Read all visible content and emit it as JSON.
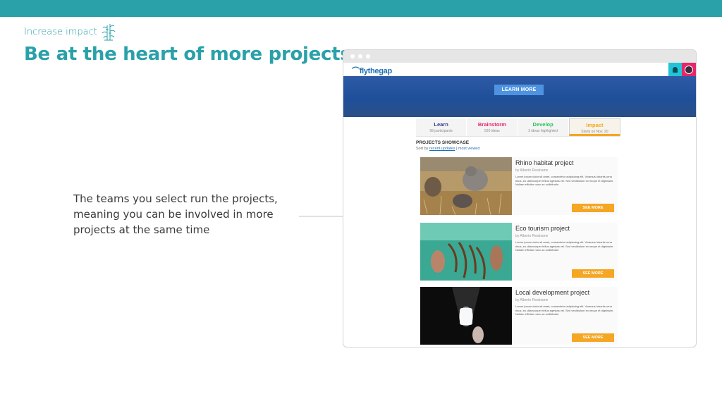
{
  "slide": {
    "kicker": "Increase impact",
    "kicker_icon": "bamboo-icon",
    "title": "Be at the heart of more projects",
    "body": "The teams you select run the projects, meaning you can be involved in more projects at the same time",
    "accent_color": "#2aa1a9"
  },
  "browser": {
    "logo": "flythegap",
    "header_icons": [
      "bell-icon",
      "avatar"
    ],
    "hero_button": "LEARN MORE",
    "tabs": [
      {
        "label": "Learn",
        "sub": "99 participants",
        "color": "#3a3a8a"
      },
      {
        "label": "Brainstorm",
        "sub": "520 ideas",
        "color": "#e6266b"
      },
      {
        "label": "Develop",
        "sub": "3 ideas highlighted",
        "color": "#2ac25a"
      },
      {
        "label": "Impact",
        "sub": "Starts on Nov. 20",
        "color": "#f5a623"
      }
    ],
    "showcase": {
      "title": "PROJECTS SHOWCASE",
      "sort_prefix": "Sort by",
      "sort_recent": "recent updates",
      "sort_sep": " | ",
      "sort_viewed": "most viewed"
    },
    "projects": [
      {
        "title": "Rhino habitat project",
        "author": "by Alberto Realname",
        "desc": "Lorem ipsum dolor sit amet, consectetur adipiscing elit. Vivamus lobortis urna risus, eu ullamcorper tellus egestas vel. Sed vestibulum ex neque et dignissim. Nullam efficitur nunc ac sollicitudin.",
        "button": "SEE MORE",
        "image": "rhino-photo"
      },
      {
        "title": "Eco tourism project",
        "author": "by Alberto Realname",
        "desc": "Lorem ipsum dolor sit amet, consectetur adipiscing elit. Vivamus lobortis urna risus, eu ullamcorper tellus egestas vel. Sed vestibulum ex neque et dignissim. Nullam efficitur nunc ac sollicitudin.",
        "button": "SEE MORE",
        "image": "underwater-photo"
      },
      {
        "title": "Local development project",
        "author": "by Alberto Realname",
        "desc": "Lorem ipsum dolor sit amet, consectetur adipiscing elit. Vivamus lobortis urna risus, eu ullamcorper tellus egestas vel. Sed vestibulum ex neque et dignissim. Nullam efficitur nunc ac sollicitudin.",
        "button": "SEE MORE",
        "image": "light-bottle-photo"
      }
    ]
  }
}
